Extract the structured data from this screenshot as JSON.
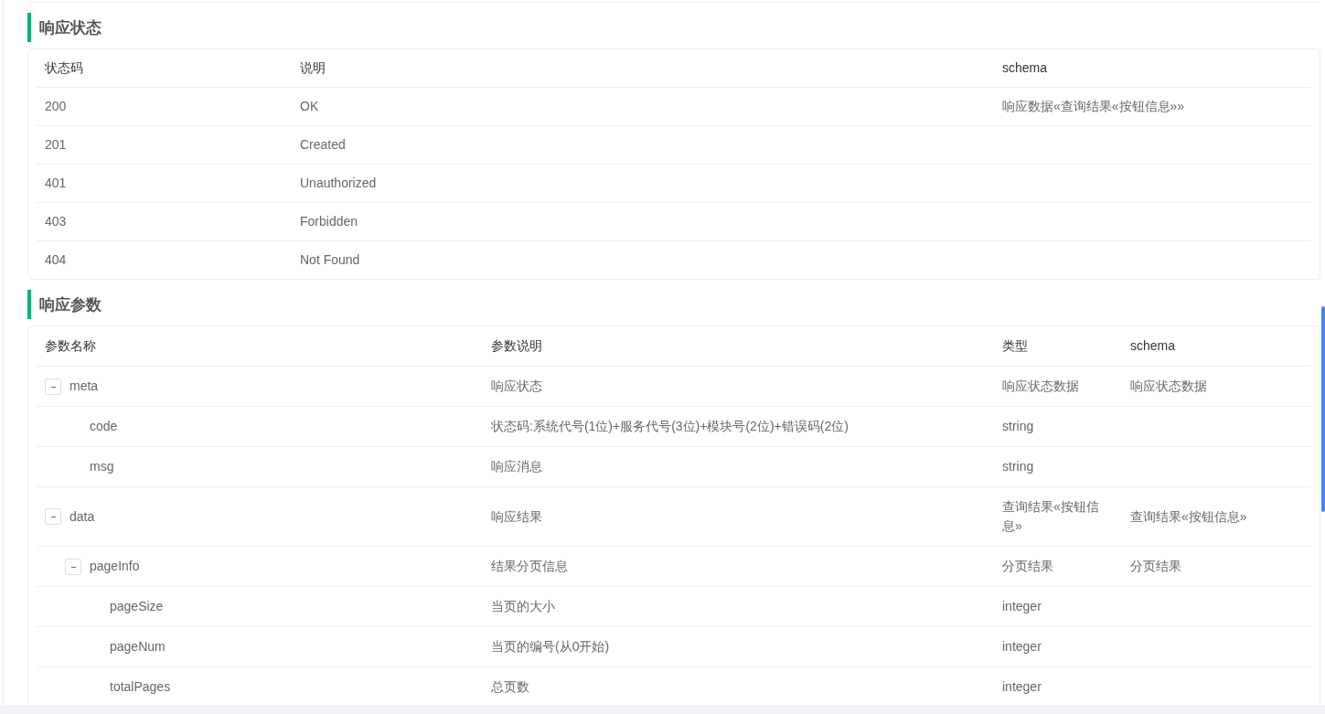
{
  "status_section": {
    "title": "响应状态",
    "columns": [
      "状态码",
      "说明",
      "schema"
    ],
    "rows": [
      [
        "200",
        "OK",
        "响应数据«查询结果«按钮信息»»"
      ],
      [
        "201",
        "Created",
        ""
      ],
      [
        "401",
        "Unauthorized",
        ""
      ],
      [
        "403",
        "Forbidden",
        ""
      ],
      [
        "404",
        "Not Found",
        ""
      ]
    ]
  },
  "params_section": {
    "title": "响应参数",
    "columns": [
      "参数名称",
      "参数说明",
      "类型",
      "schema"
    ],
    "rows": [
      {
        "name": "meta",
        "description": "响应状态",
        "type": "响应状态数据",
        "schema": "响应状态数据",
        "expanded": true,
        "children": [
          {
            "name": "code",
            "description": "状态码:系统代号(1位)+服务代号(3位)+模块号(2位)+错误码(2位)",
            "type": "string"
          },
          {
            "name": "msg",
            "description": "响应消息",
            "type": "string"
          }
        ]
      },
      {
        "name": "data",
        "description": "响应结果",
        "type": "查询结果«按钮信息»",
        "schema": "查询结果«按钮信息»",
        "expanded": true,
        "children": [
          {
            "name": "pageInfo",
            "description": "结果分页信息",
            "type": "分页结果",
            "schema": "分页结果",
            "expanded": true,
            "children": [
              {
                "name": "pageSize",
                "description": "当页的大小",
                "type": "integer"
              },
              {
                "name": "pageNum",
                "description": "当页的编号(从0开始)",
                "type": "integer"
              },
              {
                "name": "totalPages",
                "description": "总页数",
                "type": "integer"
              }
            ]
          }
        ]
      }
    ]
  }
}
